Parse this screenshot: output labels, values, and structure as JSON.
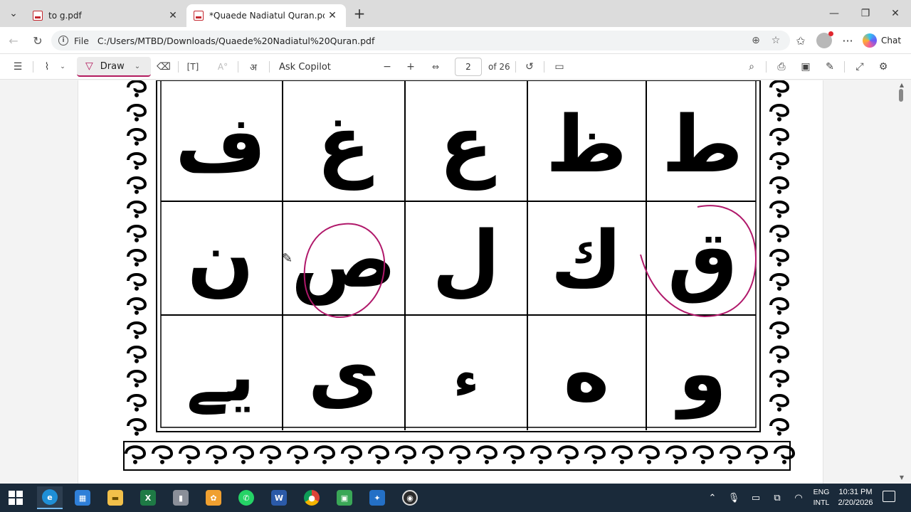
{
  "tabs": [
    {
      "title": "to g.pdf",
      "active": false
    },
    {
      "title": "*Quaede Nadiatul Quran.pdf",
      "active": true
    }
  ],
  "address": {
    "scheme_label": "File",
    "url": "C:/Users/MTBD/Downloads/Quaede%20Nadiatul%20Quran.pdf"
  },
  "copilot_label": "Chat",
  "pdf_toolbar": {
    "draw_label": "Draw",
    "ask_copilot": "Ask Copilot",
    "page_number": "2",
    "page_count": "of 26"
  },
  "letters": {
    "row1": [
      "ف",
      "غ",
      "ع",
      "ظ",
      "ط"
    ],
    "row2": [
      "ن",
      "ص",
      "ل",
      "ك",
      "ق"
    ],
    "row3": [
      "يے",
      "ى",
      "ء",
      "ه",
      "و"
    ]
  },
  "annotation_color": "#b0186a",
  "taskbar": {
    "language_line1": "ENG",
    "language_line2": "INTL",
    "time": "10:31 PM",
    "date": "2/20/2026"
  }
}
